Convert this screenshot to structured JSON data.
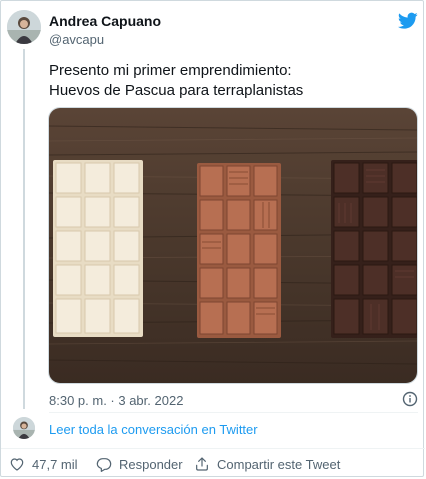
{
  "author": {
    "name": "Andrea Capuano",
    "handle": "@avcapu"
  },
  "tweet": {
    "line1": "Presento mi primer emprendimiento:",
    "line2": "Huevos de Pascua para terraplanistas",
    "timestamp": "8:30 p. m. · 3 abr. 2022"
  },
  "thread": {
    "read_link": "Leer toda la conversación en Twitter"
  },
  "actions": {
    "likes": "47,7 mil",
    "reply": "Responder",
    "share": "Compartir este Tweet"
  },
  "icons": {
    "brand": "twitter-bird-icon",
    "info": "info-icon",
    "like": "heart-icon",
    "reply": "reply-icon",
    "share": "share-icon"
  },
  "colors": {
    "twitter_blue": "#1d9bf0",
    "secondary_text": "#536471",
    "white_chocolate": "#f1e8d6",
    "milk_chocolate": "#b06c50",
    "dark_chocolate": "#4a2e26"
  }
}
